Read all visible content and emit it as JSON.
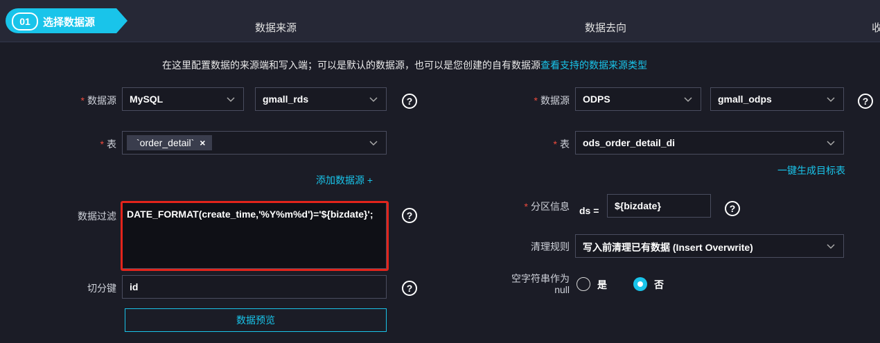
{
  "steps": {
    "active_num": "01",
    "active_label": "选择数据源",
    "step2": "数据来源",
    "step3": "数据去向",
    "step4_partial": "收"
  },
  "info": {
    "text": "在这里配置数据的来源端和写入端；可以是默认的数据源，也可以是您创建的自有数据源",
    "link": "查看支持的数据来源类型"
  },
  "source": {
    "datasource_label": "数据源",
    "datasource_type": "MySQL",
    "datasource_name": "gmall_rds",
    "table_label": "表",
    "table_tag": "`order_detail`",
    "add_datasource": "添加数据源 +",
    "filter_label": "数据过滤",
    "filter_value": "DATE_FORMAT(create_time,'%Y%m%d')='${bizdate}';",
    "split_key_label": "切分键",
    "split_key_value": "id",
    "preview_button": "数据预览"
  },
  "target": {
    "datasource_label": "数据源",
    "datasource_type": "ODPS",
    "datasource_name": "gmall_odps",
    "table_label": "表",
    "table_value": "ods_order_detail_di",
    "create_table_link": "一键生成目标表",
    "partition_label": "分区信息",
    "partition_key": "ds =",
    "partition_value": "${bizdate}",
    "clean_rule_label": "清理规则",
    "clean_rule_value": "写入前清理已有数据 (Insert Overwrite)",
    "empty_string_label_line1": "空字符串作为",
    "empty_string_label_line2": "null",
    "option_yes": "是",
    "option_no": "否",
    "selected_option": "否"
  },
  "colors": {
    "accent": "#19c4ea",
    "required": "#f04b3d",
    "highlight_box": "#e3241b",
    "background": "#1b1c26"
  }
}
